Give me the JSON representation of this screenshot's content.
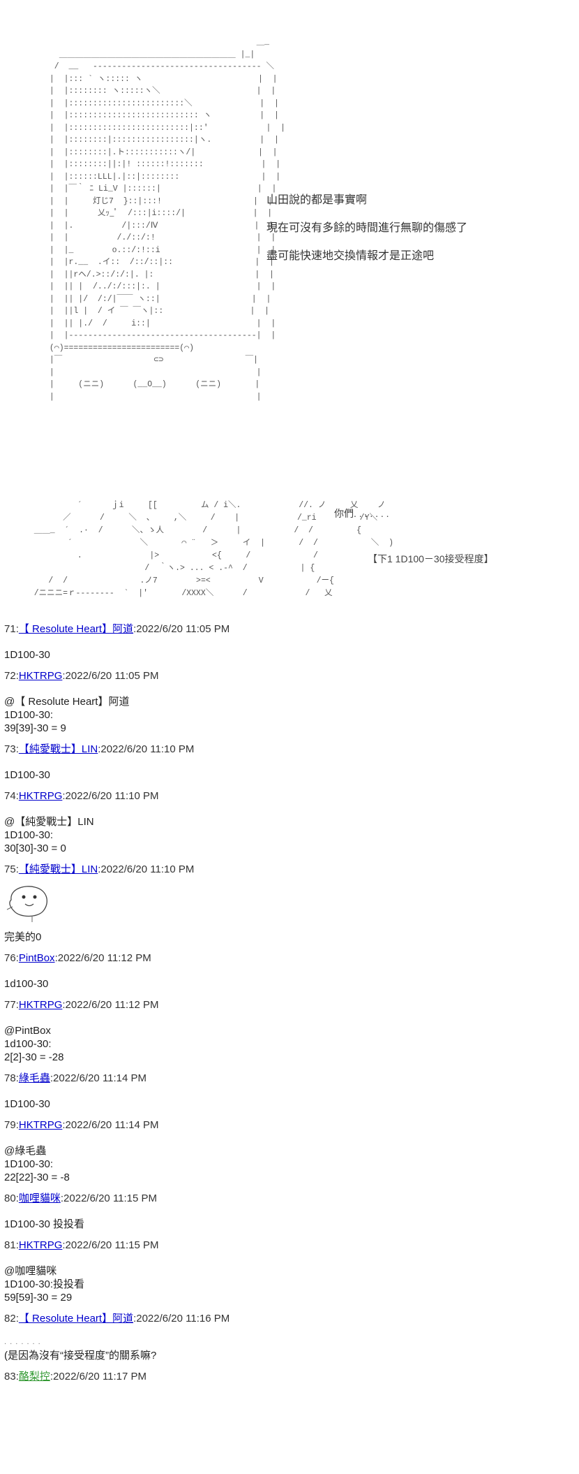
{
  "aa_phone": "                                            ＿_\n   ＿＿＿＿＿＿＿＿＿＿＿＿＿＿＿＿＿＿＿＿＿＿ |_|\n  /  __   ----------------------------------- ＼\n |  |::: ` ヽ::::: ヽ                        |  |\n |  |:::::::: ヽ:::::ヽ＼                    |  |\n |  |::::::::::::::::::::::::＼              |  |\n |  |::::::::::::::::::::::::::: ヽ          |  |\n |  |:::::::::::::::::::::::::|::'            |  |\n |  |::::::::|:::::::::::::::::|ヽ.          |  |\n |  |::::::::|.ト:::::::::::ヽ/|             |  |\n |  |::::::::||:|! ::::::!:::::::            |  |\n |  |::::::LLL|.|::|::::::::                 |  |\n |  |￣｀ ﾆ Li_V |::::::|                    |  |\n |  |     灯じ7  }::|:::!                   |  |\n |  |      乂ｯ_ﾟ  /:::|i::::/|              |  |\n |  |.          /|:::/Ⅳ                    |  |\n |  |          /./::/:!                     |  |\n |  |_        o.::/:!::i                    |  |\n |  |r.__  .イ::  /::/::|::                 |  |\n |  ||rヘ/.>::/:/:|. |:                     |  |\n |  || |  /../:/:::|:. |                    |  |\n |  || |/  /:/|￣￣ ヽ::|                   |  |\n |  ||l |  / イ ￣ ￣ヽ|::                  |  |\n |  || |./  /     i::|                      |  |\n |  |---------------------------------------|  |\n (⌒)========================(⌒)\n |￣                   ⊂⊃                 ￣|\n |                                          |\n |     (ニニ)      (__O__)      (ニニ)       |\n |                                          |",
  "dialogue": [
    "山田說的都是事實啊",
    "現在可沒有多餘的時間進行無聊的傷感了",
    "盡可能快速地交換情報才是正途吧"
  ],
  "aa_scene": "            ´      ｊi     [[         ム / i＼.            //. ノ     乂    ノ\n         ／      /     ＼  、    ,＼     /    |            /_ri         /Y＼\n   ＿＿_  ´  .·  /      ＼、ゝ人        /      |           /  /         {\n          ´              ＼       ⌒ ¨   ＞     イ  |       /  /           ＼  )\n            .              |>           <{     /             /\n                          /  ｀ヽ.> ... < .-^  /           | {\n      /  /               .ノ7        >=<          V           /ー{\n   /ニニニ=ｒ--------  `  |'       /XXXX＼      /            /   乂",
  "asides": {
    "you": "你們. . . . . . .",
    "roll": "【下1  1D100－30接受程度】"
  },
  "posts": [
    {
      "num": "71",
      "name": "【 Resolute Heart】阿道",
      "name_color": "#0000cc",
      "time": "2022/6/20 11:05 PM",
      "body": "1D100-30"
    },
    {
      "num": "72",
      "name": "HKTRPG",
      "name_color": "#0000cc",
      "time": "2022/6/20 11:05 PM",
      "body": "@【 Resolute Heart】阿道\n1D100-30:\n39[39]-30 = 9"
    },
    {
      "num": "73",
      "name": "【純愛戰士】LIN",
      "name_color": "#0000cc",
      "time": "2022/6/20 11:10 PM",
      "body": "1D100-30"
    },
    {
      "num": "74",
      "name": "HKTRPG",
      "name_color": "#0000cc",
      "time": "2022/6/20 11:10 PM",
      "body": "@【純愛戰士】LIN\n1D100-30:\n30[30]-30 = 0"
    },
    {
      "num": "75",
      "name": "【純愛戰士】LIN",
      "name_color": "#0000cc",
      "time": "2022/6/20 11:10 PM",
      "body": "完美的0"
    },
    {
      "num": "76",
      "name": "PintBox",
      "name_color": "#0000cc",
      "time": "2022/6/20 11:12 PM",
      "body": "1d100-30"
    },
    {
      "num": "77",
      "name": "HKTRPG",
      "name_color": "#0000cc",
      "time": "2022/6/20 11:12 PM",
      "body": "@PintBox\n1d100-30:\n2[2]-30 = -28"
    },
    {
      "num": "78",
      "name": "綠毛蟲",
      "name_color": "#0000cc",
      "time": "2022/6/20 11:14 PM",
      "body": "1D100-30"
    },
    {
      "num": "79",
      "name": "HKTRPG",
      "name_color": "#0000cc",
      "time": "2022/6/20 11:14 PM",
      "body": "@綠毛蟲\n1D100-30:\n22[22]-30 = -8"
    },
    {
      "num": "80",
      "name": "咖哩貓咪",
      "name_color": "#0000cc",
      "time": "2022/6/20 11:15 PM",
      "body": "1D100-30 投投看"
    },
    {
      "num": "81",
      "name": "HKTRPG",
      "name_color": "#0000cc",
      "time": "2022/6/20 11:15 PM",
      "body": "@咖哩貓咪\n1D100-30:投投看\n59[59]-30 = 29"
    },
    {
      "num": "82",
      "name": "【 Resolute Heart】阿道",
      "name_color": "#0000cc",
      "time": "2022/6/20 11:16 PM",
      "body": "(是因為沒有“接受程度”的關系嘛?"
    },
    {
      "num": "83",
      "name": "酪梨控",
      "name_color": "#339933",
      "time": "2022/6/20 11:17 PM",
      "body": ""
    }
  ]
}
